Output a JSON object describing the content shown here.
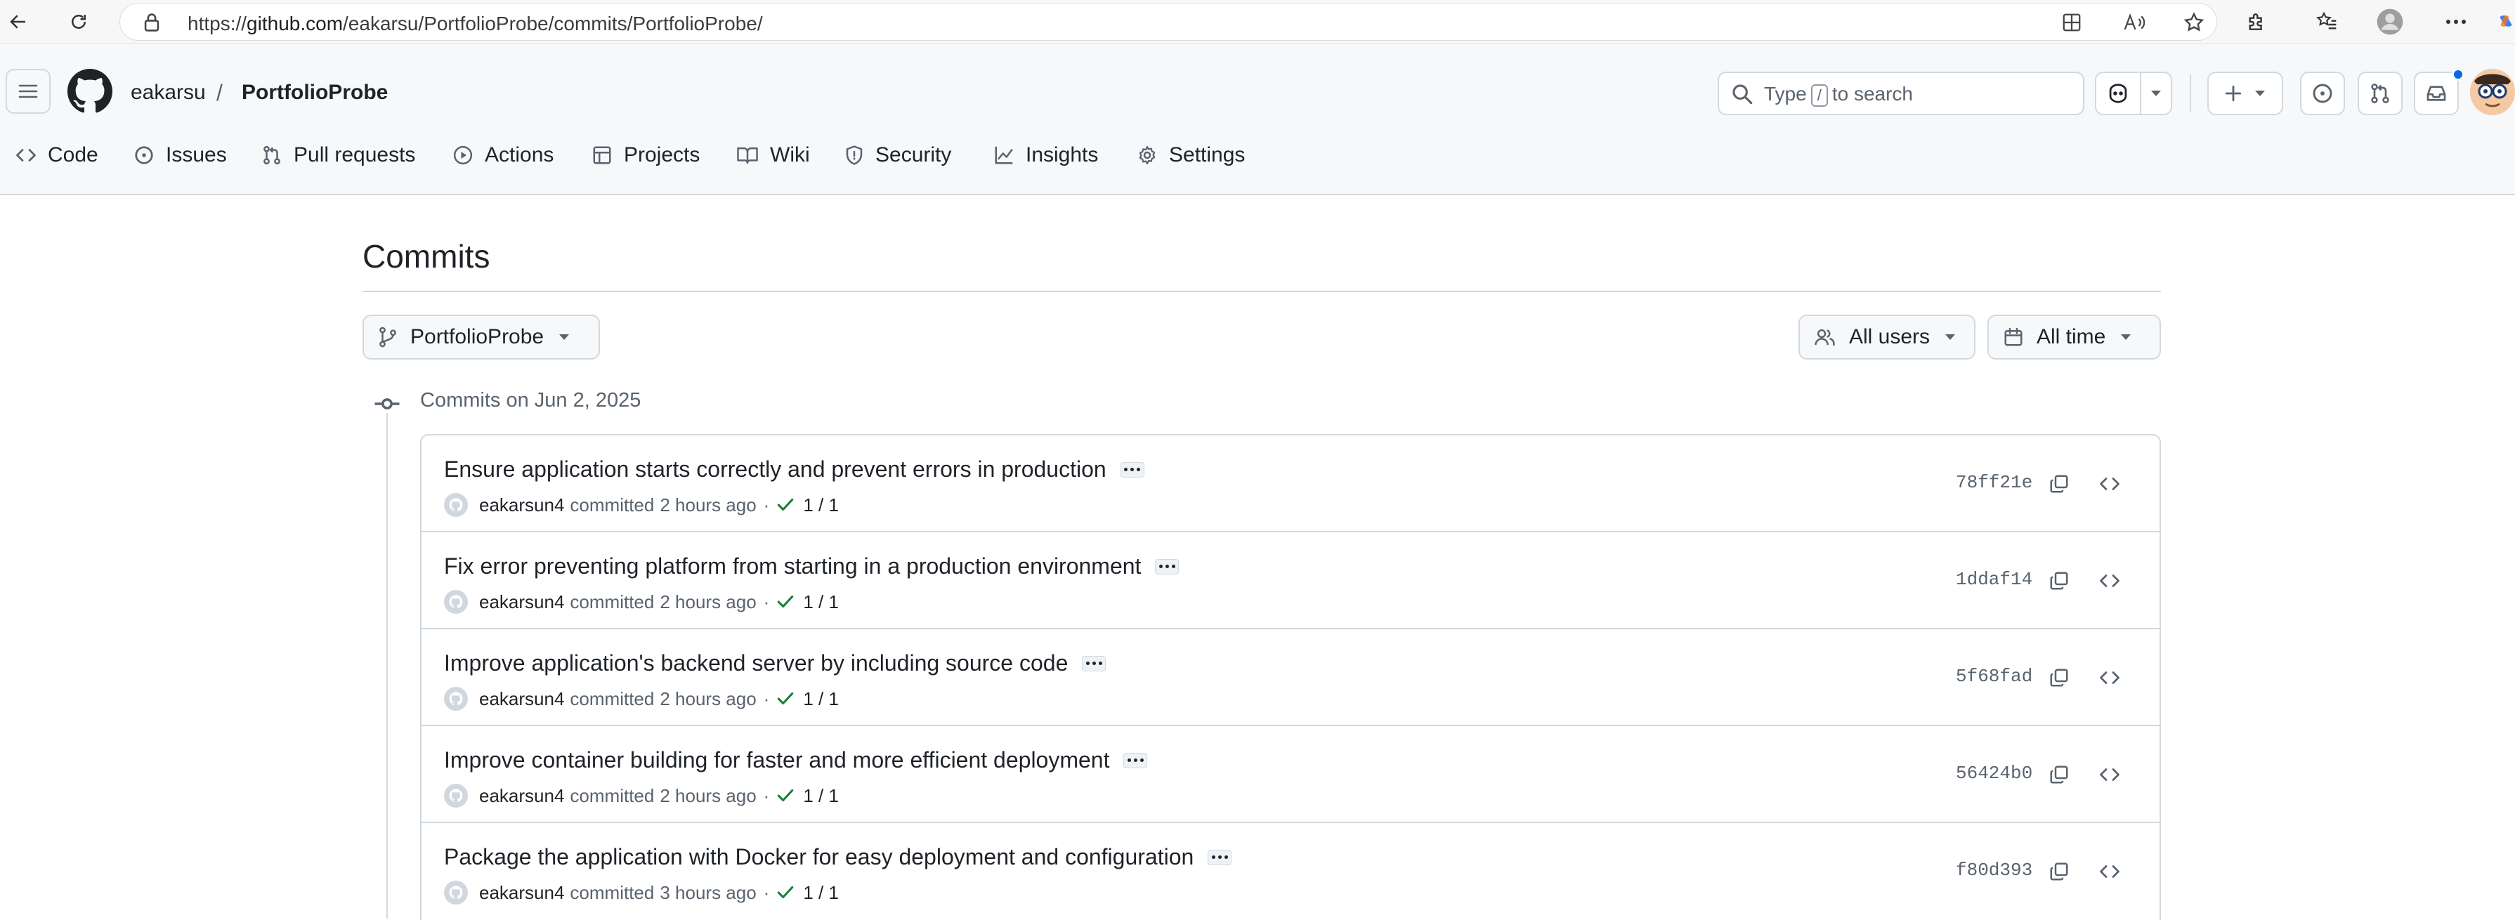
{
  "browser": {
    "url_prefix": "https://",
    "url_domain": "github.com",
    "url_path": "/eakarsu/PortfolioProbe/commits/PortfolioProbe/"
  },
  "header": {
    "owner": "eakarsu",
    "separator": "/",
    "repo": "PortfolioProbe",
    "search_before": "Type",
    "search_key": "/",
    "search_after": "to search"
  },
  "nav": {
    "items": [
      {
        "label": "Code",
        "icon": "code-icon"
      },
      {
        "label": "Issues",
        "icon": "issue-icon"
      },
      {
        "label": "Pull requests",
        "icon": "pull-request-icon"
      },
      {
        "label": "Actions",
        "icon": "play-icon"
      },
      {
        "label": "Projects",
        "icon": "table-icon"
      },
      {
        "label": "Wiki",
        "icon": "book-icon"
      },
      {
        "label": "Security",
        "icon": "shield-icon"
      },
      {
        "label": "Insights",
        "icon": "graph-icon"
      },
      {
        "label": "Settings",
        "icon": "gear-icon"
      }
    ]
  },
  "page": {
    "title": "Commits",
    "branch": "PortfolioProbe",
    "users_filter": "All users",
    "time_filter": "All time",
    "group_label": "Commits on Jun 2, 2025"
  },
  "commits": [
    {
      "message": "Ensure application starts correctly and prevent errors in production",
      "author": "eakarsun4",
      "verb": "committed",
      "time": "2 hours ago",
      "status": "1 / 1",
      "sha": "78ff21e"
    },
    {
      "message": "Fix error preventing platform from starting in a production environment",
      "author": "eakarsun4",
      "verb": "committed",
      "time": "2 hours ago",
      "status": "1 / 1",
      "sha": "1ddaf14"
    },
    {
      "message": "Improve application's backend server by including source code",
      "author": "eakarsun4",
      "verb": "committed",
      "time": "2 hours ago",
      "status": "1 / 1",
      "sha": "5f68fad"
    },
    {
      "message": "Improve container building for faster and more efficient deployment",
      "author": "eakarsun4",
      "verb": "committed",
      "time": "2 hours ago",
      "status": "1 / 1",
      "sha": "56424b0"
    },
    {
      "message": "Package the application with Docker for easy deployment and configuration",
      "author": "eakarsun4",
      "verb": "committed",
      "time": "3 hours ago",
      "status": "1 / 1",
      "sha": "f80d393"
    }
  ],
  "colors": {
    "accent": "#0969da",
    "success": "#1a7f37",
    "border": "#d1d9e0",
    "muted": "#59636e"
  }
}
